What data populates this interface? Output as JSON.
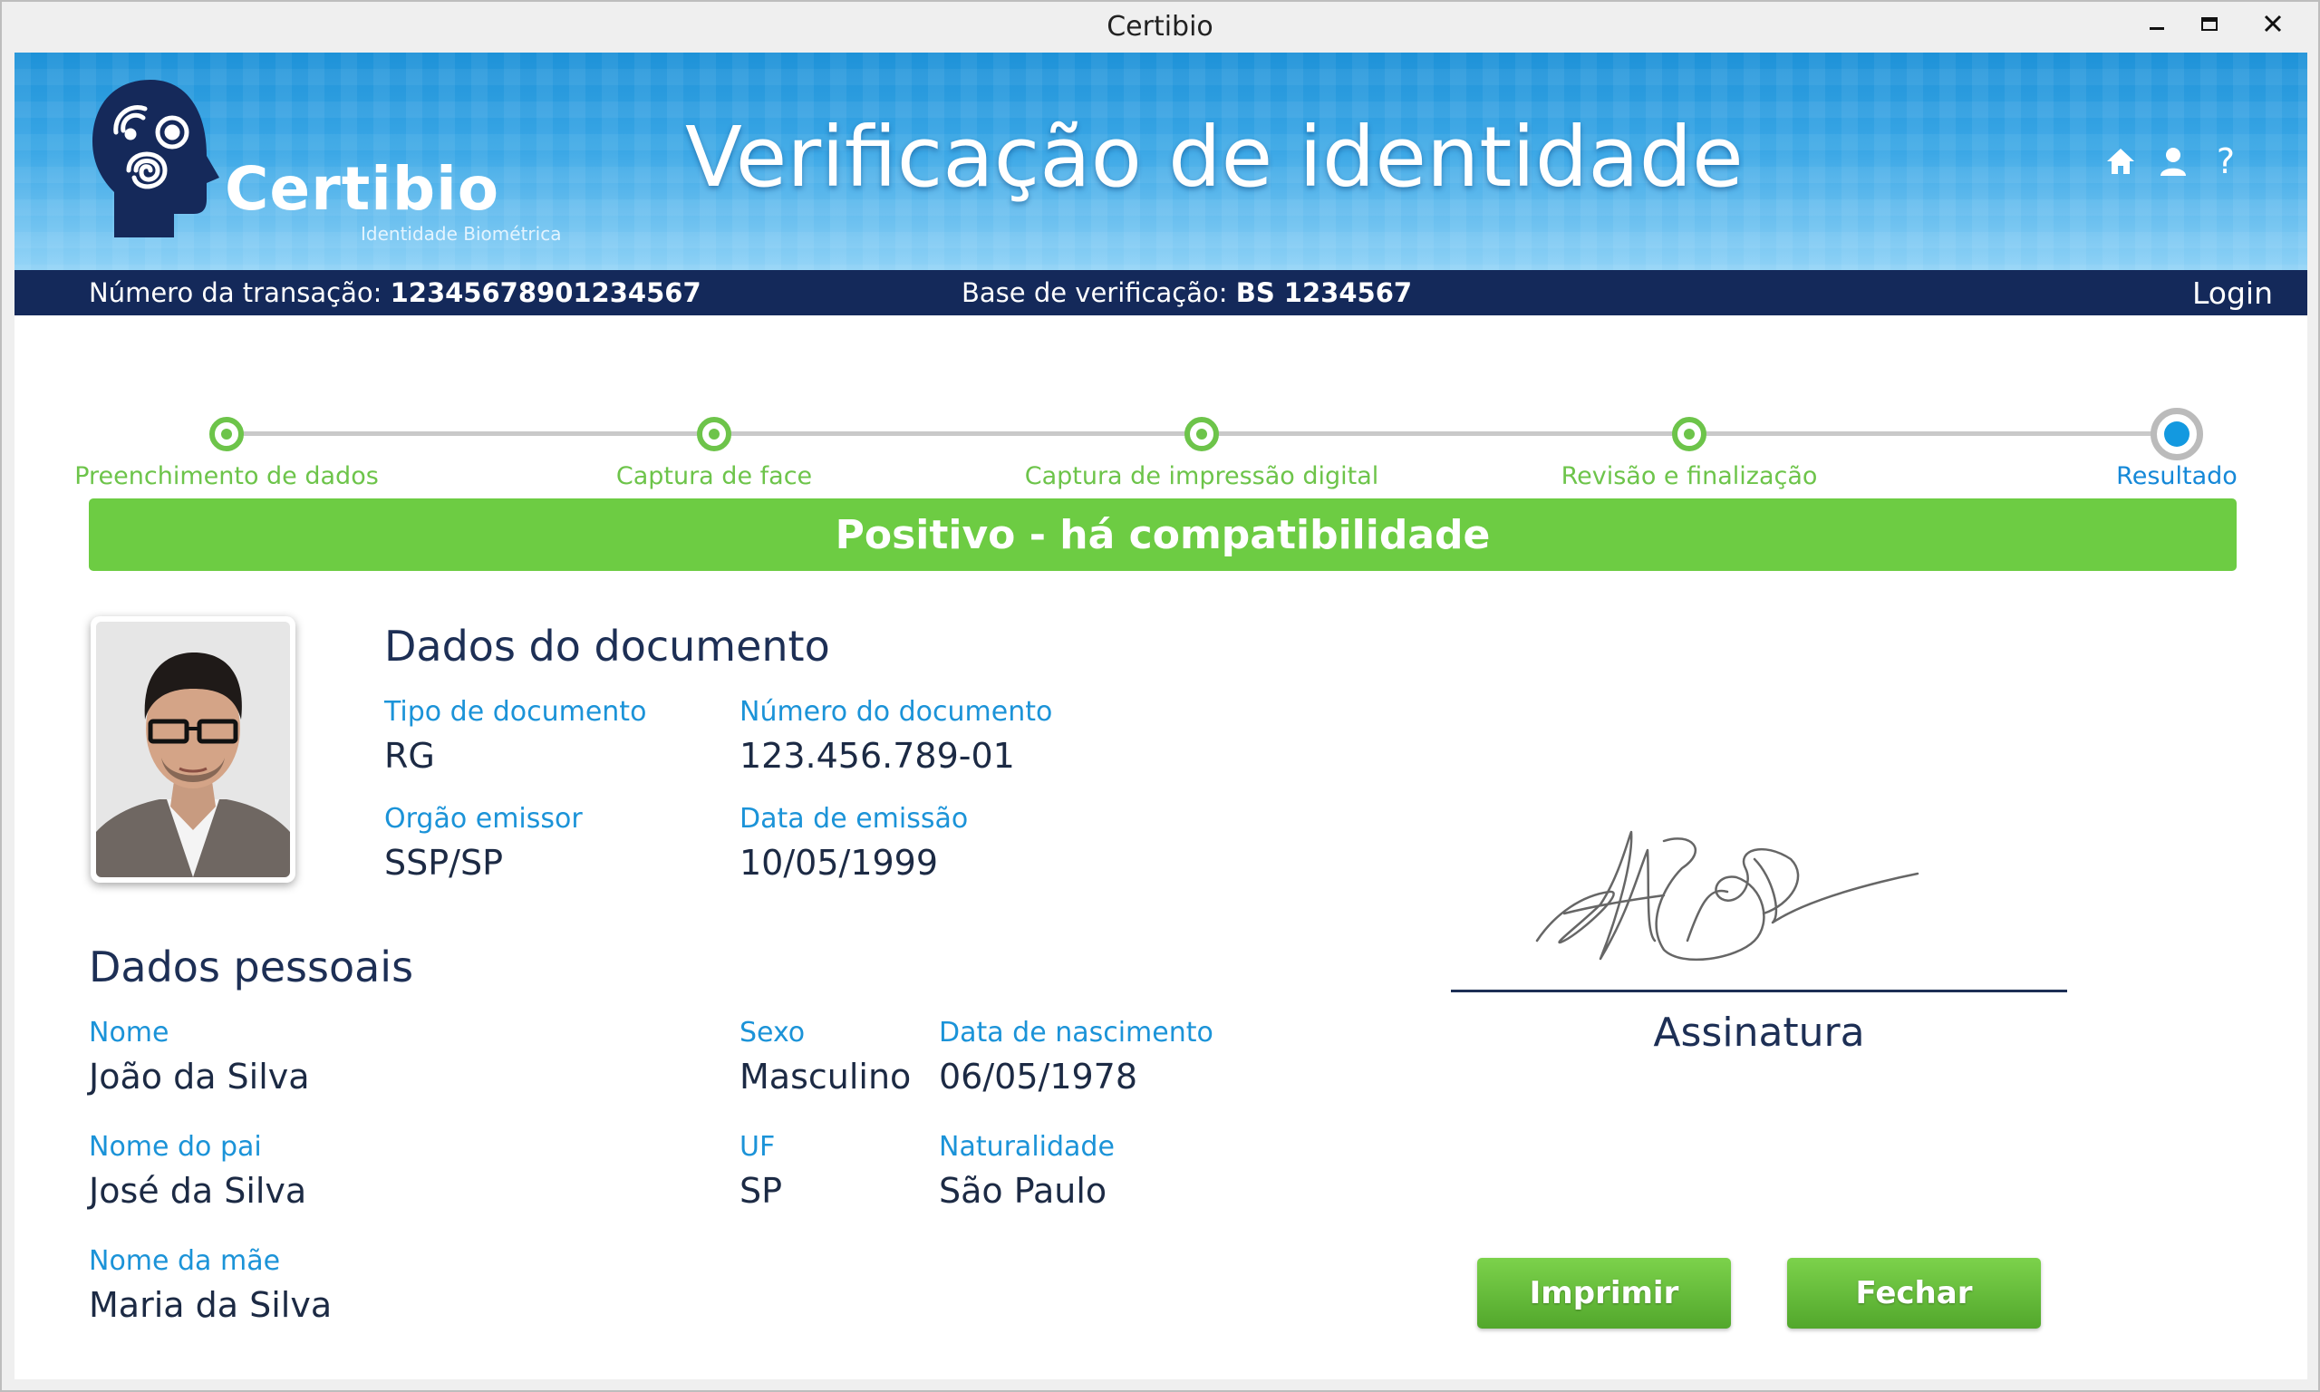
{
  "window": {
    "title": "Certibio"
  },
  "brand": {
    "name": "Certibio",
    "tagline": "Identidade Biométrica"
  },
  "header": {
    "title": "Verificação de identidade",
    "icons": [
      "home-icon",
      "user-icon",
      "help-icon"
    ],
    "help_glyph": "?"
  },
  "infobar": {
    "transaction_label": "Número da transação:",
    "transaction_value": "12345678901234567",
    "base_label": "Base de verificação:",
    "base_value": "BS 1234567",
    "login": "Login"
  },
  "steps": [
    {
      "label": "Preenchimento de dados",
      "status": "done"
    },
    {
      "label": "Captura de face",
      "status": "done"
    },
    {
      "label": "Captura de impressão digital",
      "status": "done"
    },
    {
      "label": "Revisão e finalização",
      "status": "done"
    },
    {
      "label": "Resultado",
      "status": "current"
    }
  ],
  "result": {
    "text": "Positivo - há compatibilidade",
    "color": "#6dcc43"
  },
  "document": {
    "title": "Dados do documento",
    "tipo_label": "Tipo de documento",
    "tipo_value": "RG",
    "numero_label": "Número do documento",
    "numero_value": "123.456.789-01",
    "orgao_label": "Orgão emissor",
    "orgao_value": "SSP/SP",
    "emissao_label": "Data de emissão",
    "emissao_value": "10/05/1999"
  },
  "personal": {
    "title": "Dados pessoais",
    "nome_label": "Nome",
    "nome_value": "João da Silva",
    "sexo_label": "Sexo",
    "sexo_value": "Masculino",
    "nascimento_label": "Data de nascimento",
    "nascimento_value": "06/05/1978",
    "pai_label": "Nome do pai",
    "pai_value": "José da Silva",
    "uf_label": "UF",
    "uf_value": "SP",
    "naturalidade_label": "Naturalidade",
    "naturalidade_value": "São Paulo",
    "mae_label": "Nome da mãe",
    "mae_value": "Maria da Silva"
  },
  "signature": {
    "label": "Assinatura"
  },
  "buttons": {
    "print": "Imprimir",
    "close": "Fechar"
  },
  "colors": {
    "accent_blue": "#1b93d8",
    "success_green": "#6dc44a",
    "navy": "#14295a"
  }
}
